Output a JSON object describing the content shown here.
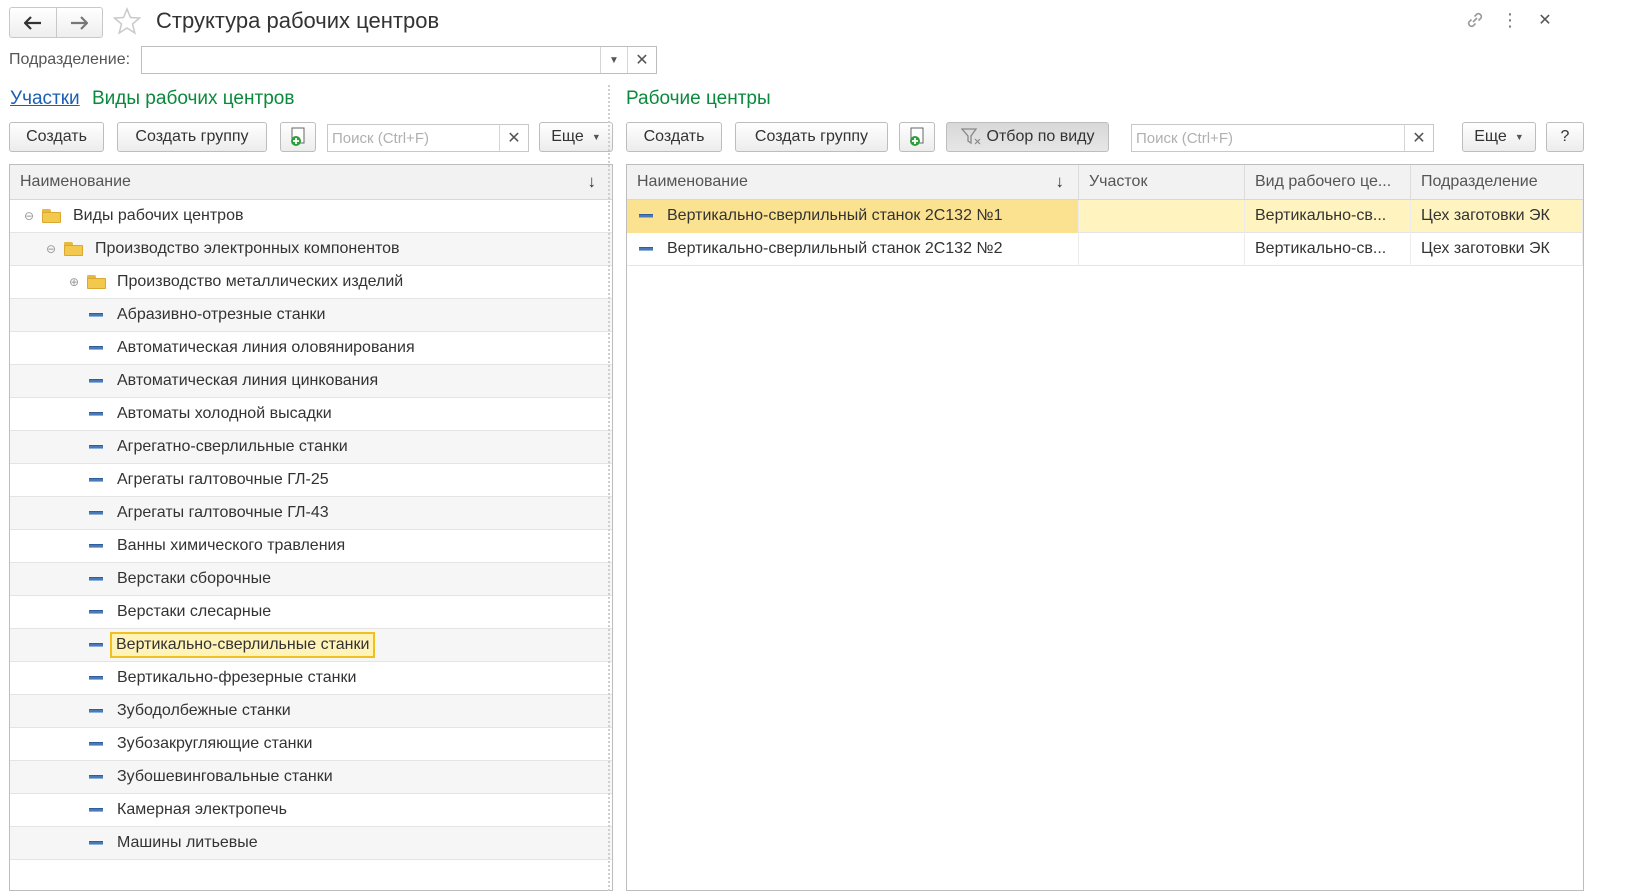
{
  "window": {
    "title": "Структура рабочих центров",
    "icons": [
      "back-arrow-icon",
      "forward-arrow-icon",
      "star-icon",
      "link-icon",
      "more-vertical-icon",
      "close-icon"
    ]
  },
  "filter": {
    "label": "Подразделение:",
    "value": ""
  },
  "left": {
    "tabs": [
      {
        "label": "Участки",
        "active": true
      },
      {
        "label": "Виды рабочих центров",
        "active": false
      }
    ],
    "toolbar": {
      "create": "Создать",
      "create_group": "Создать группу",
      "search_placeholder": "Поиск (Ctrl+F)",
      "more": "Еще"
    },
    "grid": {
      "header": "Наименование",
      "rows": [
        {
          "label": "Виды рабочих центров",
          "level": 0,
          "type": "group",
          "toggle": "⊖"
        },
        {
          "label": "Производство электронных компонентов",
          "level": 1,
          "type": "group",
          "toggle": "⊖"
        },
        {
          "label": "Производство металлических изделий",
          "level": 2,
          "type": "group",
          "toggle": "⊕"
        },
        {
          "label": "Абразивно-отрезные станки",
          "level": 2,
          "type": "item"
        },
        {
          "label": "Автоматическая линия оловянирования",
          "level": 2,
          "type": "item"
        },
        {
          "label": "Автоматическая линия цинкования",
          "level": 2,
          "type": "item"
        },
        {
          "label": "Автоматы холодной высадки",
          "level": 2,
          "type": "item"
        },
        {
          "label": "Агрегатно-сверлильные станки",
          "level": 2,
          "type": "item"
        },
        {
          "label": "Агрегаты галтовочные ГЛ-25",
          "level": 2,
          "type": "item"
        },
        {
          "label": "Агрегаты галтовочные ГЛ-43",
          "level": 2,
          "type": "item"
        },
        {
          "label": "Ванны химического травления",
          "level": 2,
          "type": "item"
        },
        {
          "label": "Верстаки сборочные",
          "level": 2,
          "type": "item"
        },
        {
          "label": "Верстаки слесарные",
          "level": 2,
          "type": "item"
        },
        {
          "label": "Вертикально-сверлильные станки",
          "level": 2,
          "type": "item",
          "selected": true
        },
        {
          "label": "Вертикально-фрезерные станки",
          "level": 2,
          "type": "item"
        },
        {
          "label": "Зубодолбежные станки",
          "level": 2,
          "type": "item"
        },
        {
          "label": "Зубозакругляющие станки",
          "level": 2,
          "type": "item"
        },
        {
          "label": "Зубошевинговальные станки",
          "level": 2,
          "type": "item"
        },
        {
          "label": "Камерная электропечь",
          "level": 2,
          "type": "item"
        },
        {
          "label": "Машины литьевые",
          "level": 2,
          "type": "item"
        }
      ]
    }
  },
  "right": {
    "heading": "Рабочие центры",
    "toolbar": {
      "create": "Создать",
      "create_group": "Создать группу",
      "filter_by_kind": "Отбор по виду",
      "search_placeholder": "Поиск (Ctrl+F)",
      "more": "Еще",
      "help": "?"
    },
    "grid": {
      "columns": [
        "Наименование",
        "Участок",
        "Вид рабочего це...",
        "Подразделение"
      ],
      "rows": [
        {
          "name": "Вертикально-сверлильный станок 2С132 №1",
          "section": "",
          "kind": "Вертикально-св...",
          "division": "Цех заготовки ЭК",
          "selected": true
        },
        {
          "name": "Вертикально-сверлильный станок 2С132 №2",
          "section": "",
          "kind": "Вертикально-св...",
          "division": "Цех заготовки ЭК",
          "selected": false
        }
      ]
    }
  },
  "colors": {
    "accent_green": "#0a8a3c",
    "link_blue": "#1a5fb4",
    "selection_yellow": "#fff3c0",
    "selection_border": "#f0c020"
  }
}
